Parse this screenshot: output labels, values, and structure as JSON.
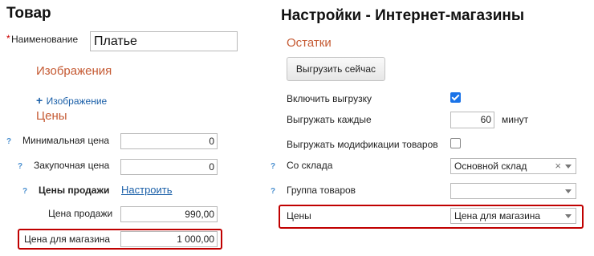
{
  "left": {
    "title": "Товар",
    "name_required": "*",
    "name_label": "Наименование",
    "name_value": "Платье",
    "images_header": "Изображения",
    "add_image_plus": "+",
    "add_image_label": "Изображение",
    "prices_header": "Цены",
    "help": "?",
    "min_price_label": "Минимальная цена",
    "min_price_value": "0",
    "purchase_price_label": "Закупочная цена",
    "purchase_price_value": "0",
    "sale_prices_label": "Цены продажи",
    "configure_link": "Настроить",
    "sale_price_label": "Цена продажи",
    "sale_price_value": "990,00",
    "shop_price_label": "Цена для магазина",
    "shop_price_value": "1 000,00"
  },
  "right": {
    "title": "Настройки - Интернет-магазины",
    "stock_header": "Остатки",
    "export_now_button": "Выгрузить сейчас",
    "enable_export_label": "Включить выгрузку",
    "enable_export_checked": true,
    "export_every_label": "Выгружать каждые",
    "export_every_value": "60",
    "export_every_unit": "минут",
    "export_modifications_label": "Выгружать модификации товаров",
    "export_modifications_checked": false,
    "help": "?",
    "warehouse_label": "Со склада",
    "warehouse_value": "Основной склад",
    "clear_glyph": "×",
    "group_label": "Группа товаров",
    "group_value": "",
    "prices_label": "Цены",
    "prices_value": "Цена для магазина"
  },
  "colors": {
    "section_header": "#c55a33",
    "link": "#1a5fa8",
    "highlight_box": "#c00000",
    "help_icon": "#4a8fcf",
    "checkbox_on": "#1a73e8"
  }
}
